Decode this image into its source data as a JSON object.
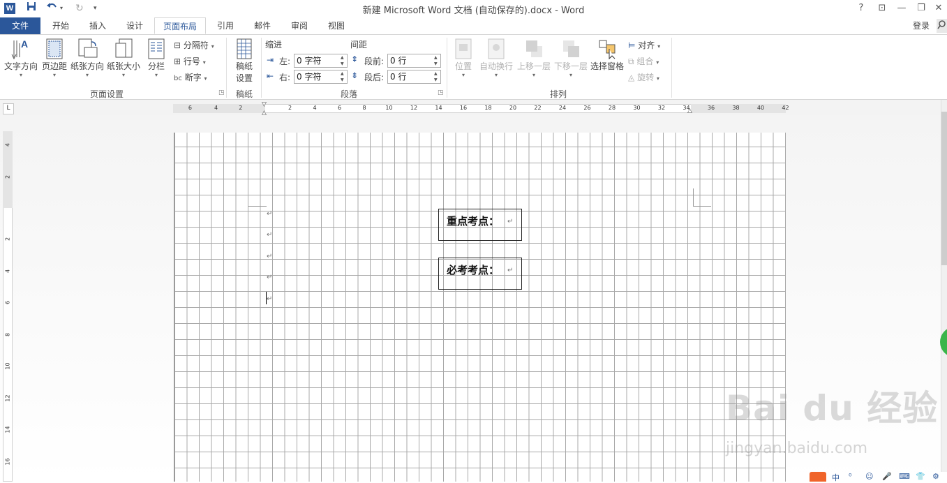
{
  "titlebar": {
    "app_icon_letter": "W",
    "title": "新建 Microsoft Word 文档 (自动保存的).docx - Word",
    "help": "?",
    "ribbon_display": "⊡",
    "minimize": "—",
    "restore": "❐",
    "close": "✕"
  },
  "tabs": {
    "file": "文件",
    "home": "开始",
    "insert": "插入",
    "design": "设计",
    "layout": "页面布局",
    "references": "引用",
    "mailings": "邮件",
    "review": "审阅",
    "view": "视图",
    "login": "登录"
  },
  "ribbon": {
    "page_setup": {
      "text_direction": "文字方向",
      "margins": "页边距",
      "orientation": "纸张方向",
      "size": "纸张大小",
      "columns": "分栏",
      "breaks": "分隔符",
      "line_numbers": "行号",
      "hyphenation": "断字",
      "label": "页面设置"
    },
    "manuscript": {
      "setup_line1": "稿纸",
      "setup_line2": "设置",
      "label": "稿纸"
    },
    "paragraph": {
      "indent_title": "缩进",
      "spacing_title": "间距",
      "left_label": "左:",
      "right_label": "右:",
      "left_value": "0 字符",
      "right_value": "0 字符",
      "before_label": "段前:",
      "after_label": "段后:",
      "before_value": "0 行",
      "after_value": "0 行",
      "label": "段落"
    },
    "arrange": {
      "position": "位置",
      "wrap_text": "自动换行",
      "bring_forward": "上移一层",
      "send_backward": "下移一层",
      "selection_pane": "选择窗格",
      "align": "对齐",
      "group": "组合",
      "rotate": "旋转",
      "label": "排列"
    }
  },
  "ruler": {
    "tab_selector": "L",
    "h_left_labels": [
      "6",
      "4",
      "2"
    ],
    "h_right_labels": [
      "2",
      "4",
      "6",
      "8",
      "10",
      "12",
      "14",
      "16",
      "18",
      "20",
      "22",
      "24",
      "26",
      "28",
      "30",
      "32",
      "34",
      "36",
      "38",
      "40",
      "42"
    ],
    "v_top_labels": [
      "4",
      "2"
    ],
    "v_labels": [
      "2",
      "4",
      "6",
      "8",
      "10",
      "12",
      "14",
      "16"
    ]
  },
  "document": {
    "paragraph_mark": "↵",
    "textbox1": "重点考点：",
    "textbox2": "必考考点："
  },
  "watermark": {
    "main": "Bai du 经验",
    "sub": "jingyan.baidu.com"
  },
  "ime": {
    "items": [
      "中",
      "⁰",
      "☺",
      "🎤",
      "⌨",
      "👕",
      "⚙"
    ]
  }
}
